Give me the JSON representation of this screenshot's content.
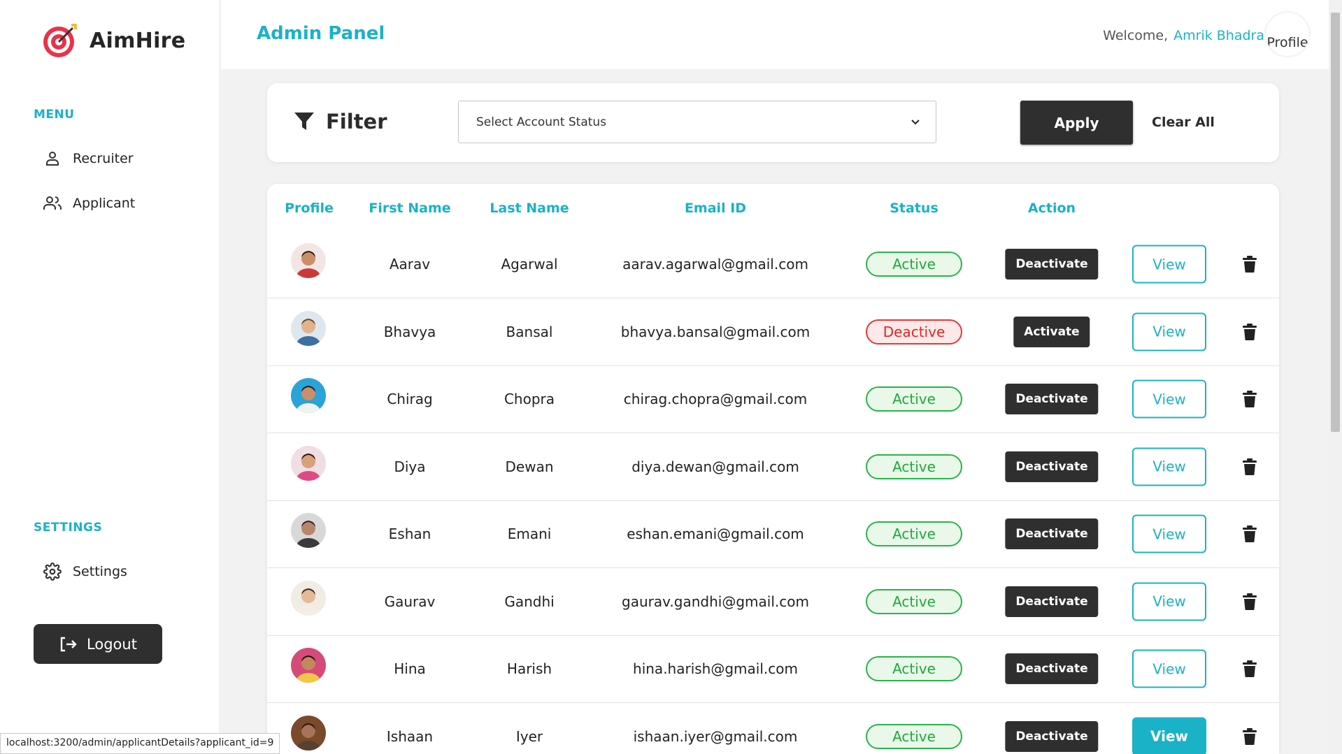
{
  "app": {
    "name": "AimHire"
  },
  "sidebar": {
    "menu_title": "MENU",
    "menu_items": [
      {
        "label": "Recruiter",
        "icon": "recruiter-icon"
      },
      {
        "label": "Applicant",
        "icon": "users-icon"
      }
    ],
    "settings_title": "SETTINGS",
    "settings_item": {
      "label": "Settings",
      "icon": "gear-icon"
    },
    "logout_label": "Logout"
  },
  "header": {
    "title": "Admin Panel",
    "welcome": "Welcome,",
    "user_name": "Amrik Bhadra",
    "profile_alt": "Profile"
  },
  "filter": {
    "label": "Filter",
    "select_value": "Select Account Status",
    "apply_label": "Apply",
    "clear_label": "Clear All"
  },
  "table": {
    "headers": [
      "Profile",
      "First Name",
      "Last Name",
      "Email ID",
      "Status",
      "Action"
    ],
    "view_label": "View",
    "rows": [
      {
        "first": "Aarav",
        "last": "Agarwal",
        "email": "aarav.agarwal@gmail.com",
        "status": "Active",
        "action": "Deactivate"
      },
      {
        "first": "Bhavya",
        "last": "Bansal",
        "email": "bhavya.bansal@gmail.com",
        "status": "Deactive",
        "action": "Activate"
      },
      {
        "first": "Chirag",
        "last": "Chopra",
        "email": "chirag.chopra@gmail.com",
        "status": "Active",
        "action": "Deactivate"
      },
      {
        "first": "Diya",
        "last": "Dewan",
        "email": "diya.dewan@gmail.com",
        "status": "Active",
        "action": "Deactivate"
      },
      {
        "first": "Eshan",
        "last": "Emani",
        "email": "eshan.emani@gmail.com",
        "status": "Active",
        "action": "Deactivate"
      },
      {
        "first": "Gaurav",
        "last": "Gandhi",
        "email": "gaurav.gandhi@gmail.com",
        "status": "Active",
        "action": "Deactivate"
      },
      {
        "first": "Hina",
        "last": "Harish",
        "email": "hina.harish@gmail.com",
        "status": "Active",
        "action": "Deactivate"
      },
      {
        "first": "Ishaan",
        "last": "Iyer",
        "email": "ishaan.iyer@gmail.com",
        "status": "Active",
        "action": "Deactivate"
      }
    ]
  },
  "status_bar": {
    "url": "localhost:3200/admin/applicantDetails?applicant_id=9"
  },
  "colors": {
    "accent": "#1ab2c6",
    "dark": "#2f2f2f",
    "active": "#22a83e",
    "deactive": "#e02525"
  }
}
